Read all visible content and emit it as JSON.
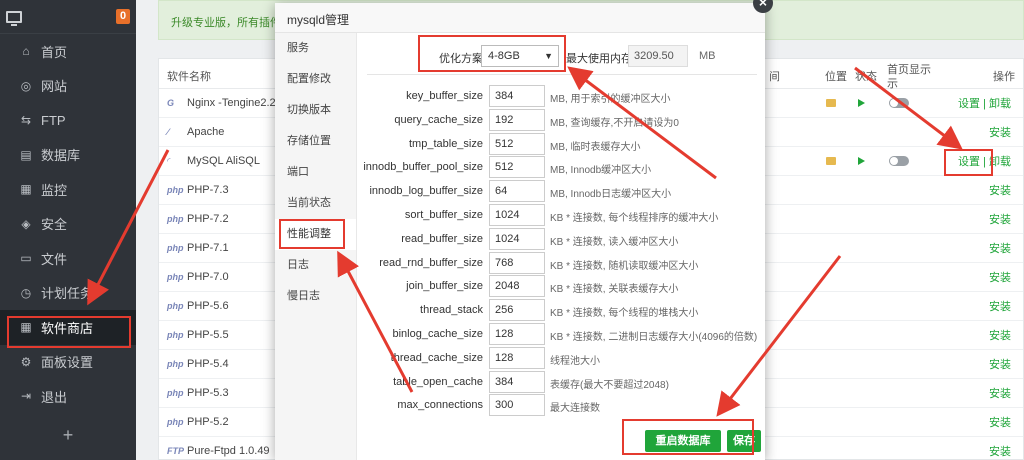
{
  "sidebar": {
    "badge": "0",
    "items": [
      {
        "label": "首页",
        "icon": "home-icon",
        "glyph": "⌂"
      },
      {
        "label": "网站",
        "icon": "globe-icon",
        "glyph": "◎"
      },
      {
        "label": "FTP",
        "icon": "ftp-icon",
        "glyph": "⇆"
      },
      {
        "label": "数据库",
        "icon": "database-icon",
        "glyph": "▤"
      },
      {
        "label": "监控",
        "icon": "monitor-icon",
        "glyph": "▦"
      },
      {
        "label": "安全",
        "icon": "shield-icon",
        "glyph": "◈"
      },
      {
        "label": "文件",
        "icon": "folder-icon",
        "glyph": "▭"
      },
      {
        "label": "计划任务",
        "icon": "clock-icon",
        "glyph": "◷"
      },
      {
        "label": "软件商店",
        "icon": "store-icon",
        "glyph": "▦"
      },
      {
        "label": "面板设置",
        "icon": "gear-icon",
        "glyph": "⚙"
      },
      {
        "label": "退出",
        "icon": "logout-icon",
        "glyph": "⇥"
      }
    ],
    "plus": "+"
  },
  "promo_text": "升级专业版，所有插件，",
  "table": {
    "headers": {
      "name": "软件名称",
      "time": "间",
      "location": "位置",
      "status": "状态",
      "home": "首页显示",
      "home2": "示",
      "ops": "操作"
    },
    "rows": [
      {
        "logo": "G",
        "name": "Nginx -Tengine2.2.",
        "action": "设置 | 卸载",
        "installed": true
      },
      {
        "logo": "⁄",
        "name": "Apache",
        "action": "安装",
        "installed": false
      },
      {
        "logo": "◜",
        "name": "MySQL AliSQL",
        "action": "设置 | 卸载",
        "installed": true
      },
      {
        "logo": "php",
        "name": "PHP-7.3",
        "action": "安装",
        "installed": false
      },
      {
        "logo": "php",
        "name": "PHP-7.2",
        "action": "安装",
        "installed": false
      },
      {
        "logo": "php",
        "name": "PHP-7.1",
        "action": "安装",
        "installed": false
      },
      {
        "logo": "php",
        "name": "PHP-7.0",
        "action": "安装",
        "installed": false
      },
      {
        "logo": "php",
        "name": "PHP-5.6",
        "action": "安装",
        "installed": false
      },
      {
        "logo": "php",
        "name": "PHP-5.5",
        "action": "安装",
        "installed": false
      },
      {
        "logo": "php",
        "name": "PHP-5.4",
        "action": "安装",
        "installed": false
      },
      {
        "logo": "php",
        "name": "PHP-5.3",
        "action": "安装",
        "installed": false
      },
      {
        "logo": "php",
        "name": "PHP-5.2",
        "action": "安装",
        "installed": false
      },
      {
        "logo": "FTP",
        "name": "Pure-Ftpd 1.0.49",
        "action": "安装",
        "installed": false
      }
    ]
  },
  "modal": {
    "title": "mysqld管理",
    "close": "×",
    "nav": [
      "服务",
      "配置修改",
      "切换版本",
      "存储位置",
      "端口",
      "当前状态",
      "性能调整",
      "日志",
      "慢日志"
    ],
    "selected_nav": "性能调整",
    "optimize_label": "优化方案",
    "optimize_value": "4-8GB",
    "max_mem_label": "最大使用内存",
    "max_mem_value": "3209.50",
    "max_mem_unit": "MB",
    "params": [
      {
        "key": "key_buffer_size",
        "value": "384",
        "desc": "MB, 用于索引的缓冲区大小"
      },
      {
        "key": "query_cache_size",
        "value": "192",
        "desc": "MB, 查询缓存,不开启请设为0"
      },
      {
        "key": "tmp_table_size",
        "value": "512",
        "desc": "MB, 临时表缓存大小"
      },
      {
        "key": "innodb_buffer_pool_size",
        "value": "512",
        "desc": "MB, Innodb缓冲区大小"
      },
      {
        "key": "innodb_log_buffer_size",
        "value": "64",
        "desc": "MB, Innodb日志缓冲区大小"
      },
      {
        "key": "sort_buffer_size",
        "value": "1024",
        "desc": "KB * 连接数, 每个线程排序的缓冲大小"
      },
      {
        "key": "read_buffer_size",
        "value": "1024",
        "desc": "KB * 连接数, 读入缓冲区大小"
      },
      {
        "key": "read_rnd_buffer_size",
        "value": "768",
        "desc": "KB * 连接数, 随机读取缓冲区大小"
      },
      {
        "key": "join_buffer_size",
        "value": "2048",
        "desc": "KB * 连接数, 关联表缓存大小"
      },
      {
        "key": "thread_stack",
        "value": "256",
        "desc": "KB * 连接数, 每个线程的堆栈大小"
      },
      {
        "key": "binlog_cache_size",
        "value": "128",
        "desc": "KB * 连接数, 二进制日志缓存大小(4096的倍数)"
      },
      {
        "key": "thread_cache_size",
        "value": "128",
        "desc": "线程池大小"
      },
      {
        "key": "table_open_cache",
        "value": "384",
        "desc": "表缓存(最大不要超过2048)"
      },
      {
        "key": "max_connections",
        "value": "300",
        "desc": "最大连接数"
      }
    ],
    "restart_label": "重启数据库",
    "save_label": "保存"
  },
  "colors": {
    "accent": "#20a53a",
    "highlight": "#e43b2f",
    "sidebar": "#2f3339"
  }
}
